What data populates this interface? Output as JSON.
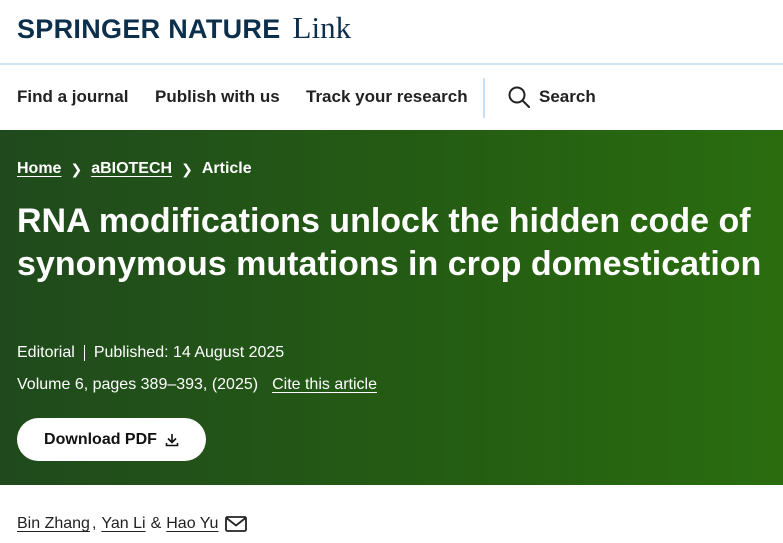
{
  "header": {
    "brand": "SPRINGER NATURE",
    "product": "Link"
  },
  "nav": {
    "items": [
      {
        "label": "Find a journal"
      },
      {
        "label": "Publish with us"
      },
      {
        "label": "Track your research"
      }
    ],
    "search_label": "Search"
  },
  "breadcrumb": [
    {
      "label": "Home"
    },
    {
      "label": "aBIOTECH"
    },
    {
      "label": "Article"
    }
  ],
  "article": {
    "title": "RNA modifications unlock the hidden code of synonymous mutations in crop domestication",
    "type": "Editorial",
    "published": "Published: 14 August 2025",
    "volume_info": "Volume 6, pages 389–393, (2025)",
    "cite_label": "Cite this article",
    "download_label": "Download PDF"
  },
  "authors": {
    "names": [
      "Bin Zhang",
      "Yan Li",
      "Hao Yu"
    ],
    "separators": [
      ",",
      "&"
    ]
  },
  "colors": {
    "brand_navy": "#0c2f4c",
    "hero_green_dark": "#204a1d",
    "hero_green_light": "#2a6d0f",
    "nav_border": "#d2e4f7"
  },
  "icons": [
    "search-icon",
    "chevron-right-icon",
    "download-icon",
    "envelope-icon"
  ]
}
